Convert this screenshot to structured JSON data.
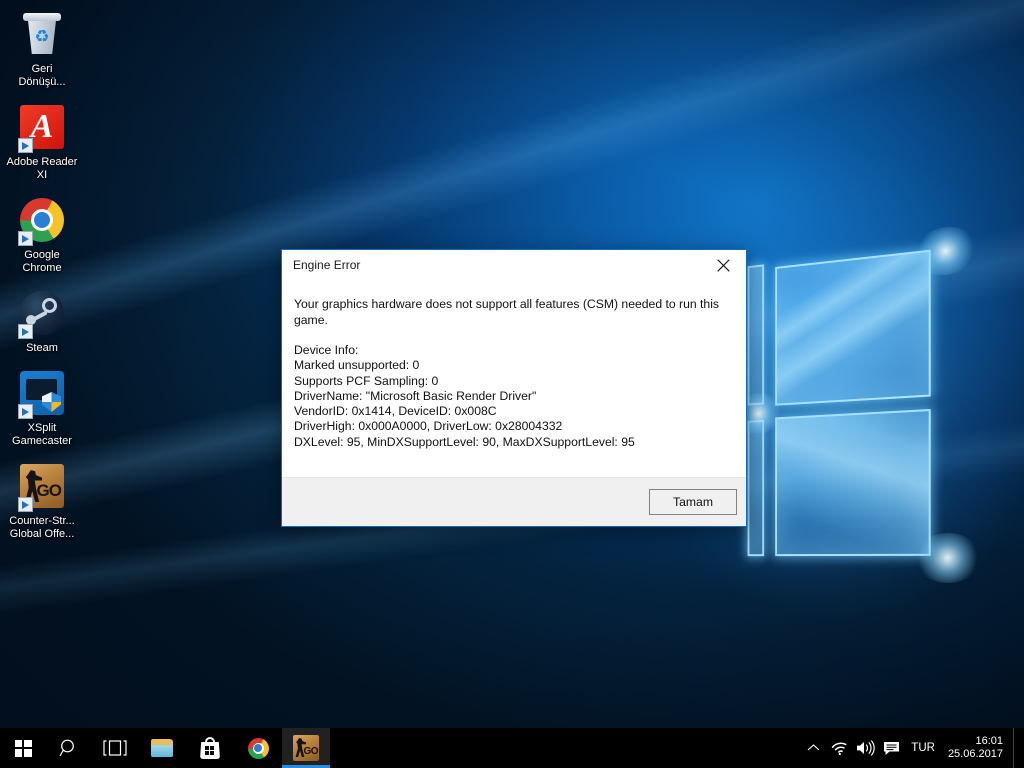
{
  "desktop": {
    "icons": [
      {
        "name": "recycle-bin",
        "label": "Geri\nDönüşü...",
        "icon": "recycle-bin-icon",
        "shortcut": false
      },
      {
        "name": "adobe-reader-xi",
        "label": "Adobe Reader\nXI",
        "icon": "adobe-reader-icon",
        "shortcut": true
      },
      {
        "name": "google-chrome",
        "label": "Google\nChrome",
        "icon": "chrome-icon",
        "shortcut": true
      },
      {
        "name": "steam",
        "label": "Steam",
        "icon": "steam-icon",
        "shortcut": true
      },
      {
        "name": "xsplit-gamecaster",
        "label": "XSplit\nGamecaster",
        "icon": "xsplit-gamecaster-icon",
        "shortcut": true
      },
      {
        "name": "counter-strike",
        "label": "Counter-Str...\nGlobal Offe...",
        "icon": "csgo-icon",
        "shortcut": true
      }
    ]
  },
  "dialog": {
    "title": "Engine Error",
    "close_label": "✕",
    "message": "Your graphics hardware does not support all features (CSM) needed to run this game.",
    "device_info_lines": [
      "Device Info:",
      "Marked unsupported: 0",
      "Supports PCF Sampling: 0",
      "DriverName: \"Microsoft Basic Render Driver\"",
      "VendorID: 0x1414, DeviceID: 0x008C",
      "DriverHigh: 0x000A0000, DriverLow: 0x28004332",
      "DXLevel: 95, MinDXSupportLevel: 90, MaxDXSupportLevel: 95"
    ],
    "ok_label": "Tamam",
    "accent_color": "#0a6ebd",
    "footer_color": "#f0f0f0"
  },
  "taskbar": {
    "items": [
      {
        "name": "start",
        "icon": "windows-start-icon",
        "active": false
      },
      {
        "name": "search",
        "icon": "search-icon",
        "active": false
      },
      {
        "name": "task-view",
        "icon": "task-view-icon",
        "active": false
      },
      {
        "name": "file-explorer",
        "icon": "folder-icon",
        "active": false
      },
      {
        "name": "microsoft-store",
        "icon": "store-icon",
        "active": false
      },
      {
        "name": "google-chrome",
        "icon": "chrome-icon",
        "active": false
      },
      {
        "name": "csgo",
        "icon": "csgo-icon",
        "active": true
      }
    ],
    "tray": {
      "overflow_icon": "chevron-up-icon",
      "network_icon": "wifi-icon",
      "volume_icon": "speaker-icon",
      "action_center_icon": "action-center-icon",
      "language": "TUR",
      "time": "16:01",
      "date": "25.06.2017"
    }
  }
}
